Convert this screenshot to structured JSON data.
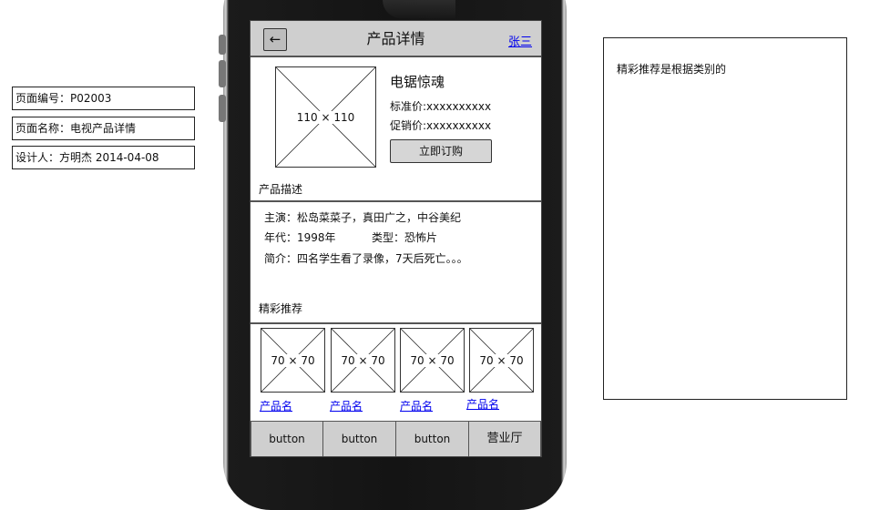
{
  "notes": {
    "page_id": "页面编号：P02003",
    "page_name": "页面名称：电视产品详情",
    "designer": "设计人：方明杰 2014-04-08"
  },
  "header": {
    "back_label": "←",
    "title": "产品详情",
    "user_link": "张三"
  },
  "product": {
    "image_label": "110 × 110",
    "name": "电锯惊魂",
    "standard_price": "标准价:xxxxxxxxxx",
    "promo_price": "促销价:xxxxxxxxxx",
    "buy_label": "立即订购"
  },
  "description": {
    "section_title": "产品描述",
    "cast": "主演：松岛菜菜子，真田广之，中谷美纪",
    "year": "年代：1998年",
    "genre": "类型：恐怖片",
    "summary": "简介：四名学生看了录像，7天后死亡。。。"
  },
  "recommend": {
    "section_title": "精彩推荐",
    "items": [
      {
        "image_label": "70 × 70",
        "name": "产品名"
      },
      {
        "image_label": "70 × 70",
        "name": "产品名"
      },
      {
        "image_label": "70 × 70",
        "name": "产品名"
      },
      {
        "image_label": "70 × 70",
        "name": "产品名"
      }
    ]
  },
  "tabbar": {
    "tabs": [
      "button",
      "button",
      "button",
      "营业厅"
    ]
  },
  "memo": {
    "text": "精彩推荐是根据类别的"
  }
}
